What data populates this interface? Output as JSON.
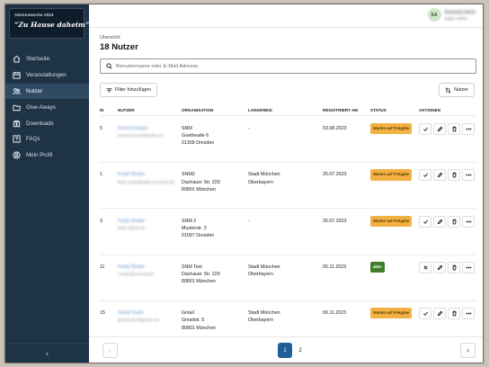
{
  "sidebar": {
    "logo_small": "Aktionswoche 2024",
    "logo_big": "“Zu Hause daheim”",
    "items": [
      {
        "label": "Startseite",
        "icon": "home-icon"
      },
      {
        "label": "Veranstaltungen",
        "icon": "calendar-icon"
      },
      {
        "label": "Nutzer",
        "icon": "users-icon",
        "active": true
      },
      {
        "label": "Give-Aways",
        "icon": "folder-icon"
      },
      {
        "label": "Downloads",
        "icon": "download-icon"
      },
      {
        "label": "FAQs",
        "icon": "help-icon"
      },
      {
        "label": "Mein Profil",
        "icon": "profile-icon"
      }
    ],
    "collapse_glyph": "‹"
  },
  "user": {
    "initials": "SA",
    "name": "Susanne Asch",
    "role": "Super Admin"
  },
  "page": {
    "breadcrumb": "Übersicht",
    "title": "18 Nutzer"
  },
  "search": {
    "placeholder": "Benutzername oder E-Mail Adresse"
  },
  "toolbar": {
    "filter_label": "Filter hinzufügen",
    "sort_label": "Nutzer"
  },
  "table": {
    "headers": {
      "id": "ID",
      "user": "NUTZER",
      "org": "ORGANISATION",
      "kreis": "LANDKREIS",
      "date": "REGISTRIERT AM",
      "status": "STATUS",
      "actions": "AKTIONEN"
    },
    "rows": [
      {
        "id": "5",
        "name": "Emma Knauss",
        "email": "emma.knauss@gmail.com",
        "org1": "SNM",
        "org2": "Goethealle 6",
        "org3": "01309 Dresden",
        "kreis1": "-",
        "kreis2": "",
        "date": "03.08.2023",
        "status": "Warten auf Freigabe",
        "status_type": "wait",
        "first_action": "check"
      },
      {
        "id": "1",
        "name": "Frank Reuter",
        "email": "frank.reuter@stadt-muenchen.de",
        "org1": "SNM2",
        "org2": "Dachauer Str. 229",
        "org3": "80801 München",
        "kreis1": "Stadt München",
        "kreis2": "Oberbayern",
        "date": "25.07.2023",
        "status": "Warten auf Freigabe",
        "status_type": "wait",
        "first_action": "check"
      },
      {
        "id": "3",
        "name": "Frank Reuter",
        "email": "frank.r@web.de",
        "org1": "SNM 2",
        "org2": "Musterstr. 3",
        "org3": "01097 Dresden",
        "kreis1": "-",
        "kreis2": "",
        "date": "26.07.2023",
        "status": "Warten auf Freigabe",
        "status_type": "wait",
        "first_action": "check"
      },
      {
        "id": "11",
        "name": "Frank Reuter",
        "email": "f.reuter@snm-test.de",
        "org1": "SNM Test",
        "org2": "Dachauer Str. 229",
        "org3": "80801 München",
        "kreis1": "Stadt München",
        "kreis2": "Oberbayern",
        "date": "05.11.2023",
        "status": "aktiv",
        "status_type": "active",
        "first_action": "x"
      },
      {
        "id": "15",
        "name": "Gmail Tester",
        "email": "gmail.tester@gmail.com",
        "org1": "Gmail",
        "org2": "Gmailstr. 5",
        "org3": "80801 München",
        "kreis1": "Stadt München",
        "kreis2": "Oberbayern",
        "date": "06.11.2023",
        "status": "Warten auf Freigabe",
        "status_type": "wait",
        "first_action": "check"
      }
    ]
  },
  "pagination": {
    "pages": [
      "1",
      "2"
    ],
    "current": "1",
    "prev": "‹",
    "next": "›"
  },
  "colors": {
    "sidebar": "#1e3346",
    "accent": "#1f5f99",
    "wait_badge": "#f3b143",
    "active_badge": "#3f7d2b"
  }
}
